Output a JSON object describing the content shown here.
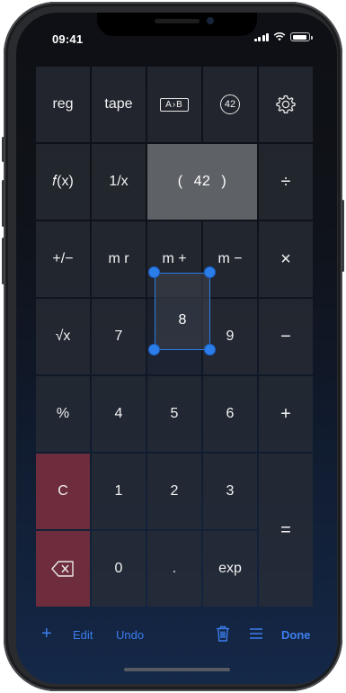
{
  "status_bar": {
    "time": "09:41"
  },
  "keys": {
    "reg": "reg",
    "tape": "tape",
    "swap": "A›B",
    "recall_badge": "42",
    "fx": "𝑓(x)",
    "reciprocal": "1/x",
    "display_open": "(",
    "display_value": "42",
    "display_close": ")",
    "divide": "÷",
    "plus_minus": "+/−",
    "mr": "m r",
    "m_plus": "m +",
    "m_minus": "m −",
    "multiply": "×",
    "sqrt": "√x",
    "seven": "7",
    "eight": "8",
    "nine": "9",
    "minus": "−",
    "percent": "%",
    "four": "4",
    "five": "5",
    "six": "6",
    "plus": "+",
    "clear": "C",
    "one": "1",
    "two": "2",
    "three": "3",
    "equals": "=",
    "zero": "0",
    "decimal": ".",
    "exp": "exp"
  },
  "toolbar": {
    "add": "+",
    "edit": "Edit",
    "undo": "Undo",
    "done": "Done"
  },
  "icons": {
    "settings": "gear-icon",
    "backspace": "backspace-icon",
    "trash": "trash-icon",
    "menu": "list-icon"
  },
  "colors": {
    "accent": "#2b7de9",
    "clear_key": "#6e2d3c",
    "display_key": "#5e6166"
  }
}
